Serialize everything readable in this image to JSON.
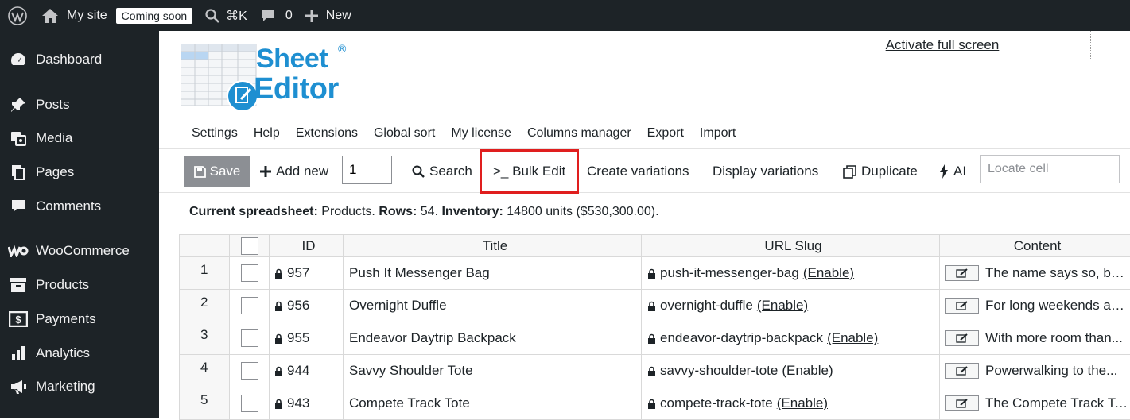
{
  "admin_bar": {
    "site_name": "My site",
    "coming_soon": "Coming soon",
    "search_shortcut": "⌘K",
    "comments_count": "0",
    "new_label": "New"
  },
  "sidebar": {
    "items": [
      {
        "label": "Dashboard",
        "icon": "dashboard-icon"
      },
      {
        "label": "Posts",
        "icon": "pin-icon"
      },
      {
        "label": "Media",
        "icon": "media-icon"
      },
      {
        "label": "Pages",
        "icon": "pages-icon"
      },
      {
        "label": "Comments",
        "icon": "comment-icon"
      },
      {
        "label": "WooCommerce",
        "icon": "woocommerce-icon"
      },
      {
        "label": "Products",
        "icon": "archive-icon"
      },
      {
        "label": "Payments",
        "icon": "payments-icon"
      },
      {
        "label": "Analytics",
        "icon": "analytics-icon"
      },
      {
        "label": "Marketing",
        "icon": "megaphone-icon"
      }
    ]
  },
  "fullscreen": {
    "label": "Activate full screen"
  },
  "logo": {
    "line1": "Sheet",
    "line2": "Editor",
    "registered": "®"
  },
  "menu": {
    "items": [
      "Settings",
      "Help",
      "Extensions",
      "Global sort",
      "My license",
      "Columns manager",
      "Export",
      "Import"
    ]
  },
  "toolbar": {
    "save": "Save",
    "add_new": "Add new",
    "add_new_qty": "1",
    "search": "Search",
    "bulk_edit": ">_ Bulk Edit",
    "create_variations": "Create variations",
    "display_variations": "Display variations",
    "duplicate": "Duplicate",
    "ai": "AI",
    "locate_placeholder": "Locate cell"
  },
  "info": {
    "spreadsheet_label": "Current spreadsheet:",
    "spreadsheet_value": "Products.",
    "rows_label": "Rows:",
    "rows_value": "54.",
    "inventory_label": "Inventory:",
    "inventory_value": "14800 units ($530,300.00)."
  },
  "table": {
    "columns": [
      "ID",
      "Title",
      "URL Slug",
      "Content"
    ],
    "enable_label": "(Enable)",
    "rows": [
      {
        "num": "1",
        "id": "957",
        "title": "Push It Messenger Bag",
        "slug": "push-it-messenger-bag",
        "content": "The name says so, but..."
      },
      {
        "num": "2",
        "id": "956",
        "title": "Overnight Duffle",
        "slug": "overnight-duffle",
        "content": "For long weekends and..."
      },
      {
        "num": "3",
        "id": "955",
        "title": "Endeavor Daytrip Backpack",
        "slug": "endeavor-daytrip-backpack",
        "content": "With more room than..."
      },
      {
        "num": "4",
        "id": "944",
        "title": "Savvy Shoulder Tote",
        "slug": "savvy-shoulder-tote",
        "content": "Powerwalking to the..."
      },
      {
        "num": "5",
        "id": "943",
        "title": "Compete Track Tote",
        "slug": "compete-track-tote",
        "content": "The Compete Track Tote..."
      }
    ]
  }
}
